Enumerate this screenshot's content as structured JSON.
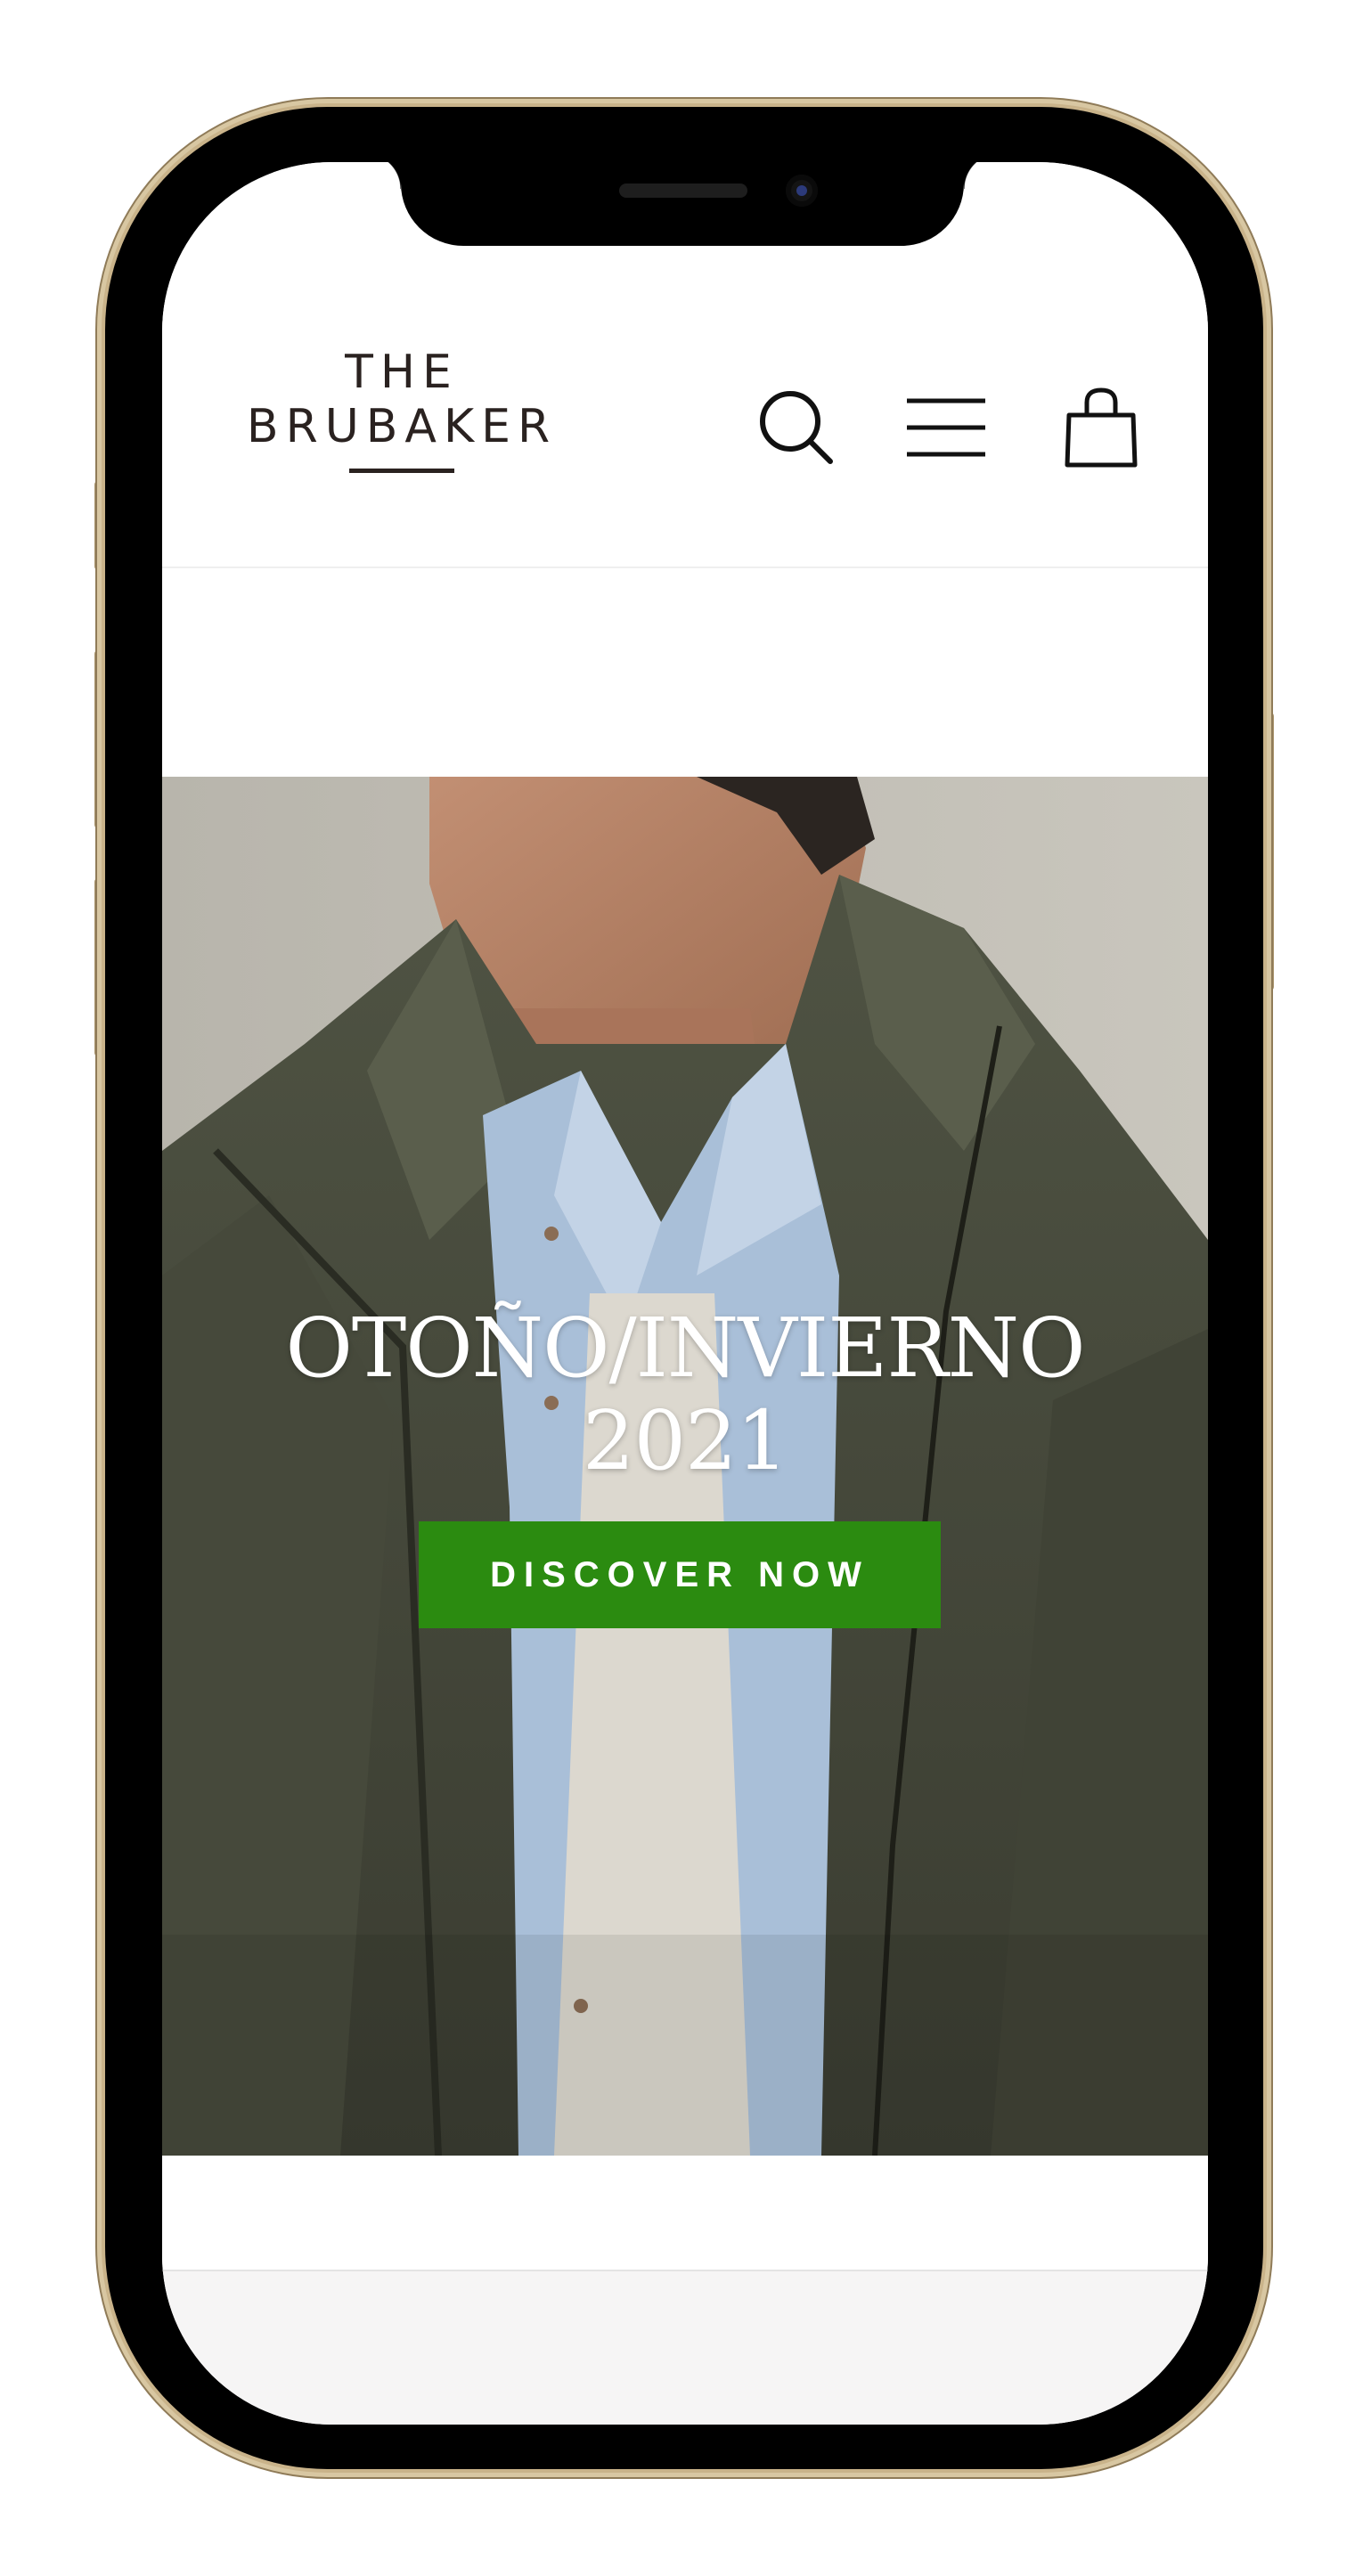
{
  "brand": {
    "logo_line1": "THE",
    "logo_line2": "BRUBAKER"
  },
  "header": {
    "icons": [
      "search-icon",
      "menu-icon",
      "cart-icon"
    ]
  },
  "hero": {
    "title_line1": "OTOÑO/INVIERNO",
    "title_line2": "2021",
    "cta_label": "DISCOVER NOW",
    "cta_color": "#2b8b10"
  },
  "device": {
    "frame_color": "#d8c7a2"
  }
}
